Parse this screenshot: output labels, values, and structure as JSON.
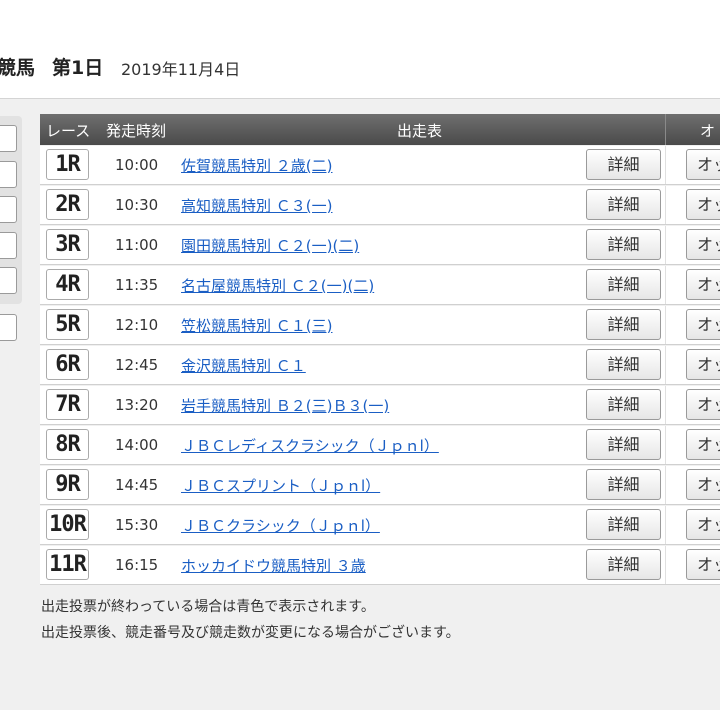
{
  "header": {
    "venue": "競馬",
    "day": "第1日",
    "date": "2019年11月4日"
  },
  "table": {
    "columns": {
      "race": "レース",
      "time": "発走時刻",
      "entries": "出走表",
      "odds": "オ"
    },
    "detail_label": "詳細",
    "odds_label": "オッ",
    "rows": [
      {
        "no": "1R",
        "time": "10:00",
        "name": "佐賀競馬特別 ２歳(二)"
      },
      {
        "no": "2R",
        "time": "10:30",
        "name": "高知競馬特別 Ｃ３(一)"
      },
      {
        "no": "3R",
        "time": "11:00",
        "name": "園田競馬特別 Ｃ２(一)(二)"
      },
      {
        "no": "4R",
        "time": "11:35",
        "name": "名古屋競馬特別 Ｃ２(一)(二)"
      },
      {
        "no": "5R",
        "time": "12:10",
        "name": "笠松競馬特別 Ｃ１(三)"
      },
      {
        "no": "6R",
        "time": "12:45",
        "name": "金沢競馬特別 Ｃ１"
      },
      {
        "no": "7R",
        "time": "13:20",
        "name": "岩手競馬特別 Ｂ２(三)Ｂ３(一)"
      },
      {
        "no": "8R",
        "time": "14:00",
        "name": "ＪＢＣレディスクラシック（Ｊｐｎl）"
      },
      {
        "no": "9R",
        "time": "14:45",
        "name": "ＪＢＣスプリント（Ｊｐｎl）"
      },
      {
        "no": "10R",
        "time": "15:30",
        "name": "ＪＢＣクラシック（Ｊｐｎl）"
      },
      {
        "no": "11R",
        "time": "16:15",
        "name": "ホッカイドウ競馬特別 ３歳"
      }
    ]
  },
  "notes": [
    "出走投票が終わっている場合は青色で表示されます。",
    "出走投票後、競走番号及び競走数が変更になる場合がございます。"
  ]
}
